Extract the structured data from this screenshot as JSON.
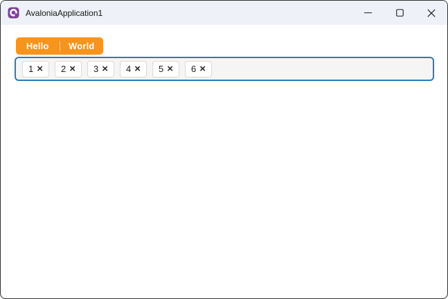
{
  "window": {
    "title": "AvaloniaApplication1",
    "controls": {
      "minimize": "minimize",
      "maximize": "maximize",
      "close": "close"
    }
  },
  "tab_strip": {
    "tabs": [
      {
        "label": "Hello"
      },
      {
        "label": "World"
      }
    ]
  },
  "chip_input": {
    "remove_glyph": "×",
    "chips": [
      {
        "label": "1"
      },
      {
        "label": "2"
      },
      {
        "label": "3"
      },
      {
        "label": "4"
      },
      {
        "label": "5"
      },
      {
        "label": "6"
      }
    ]
  },
  "colors": {
    "accent_orange": "#f7941d",
    "focus_border_blue": "#2b7bb9",
    "logo_purple": "#7c3f98",
    "titlebar_bg": "#eef2f8"
  }
}
